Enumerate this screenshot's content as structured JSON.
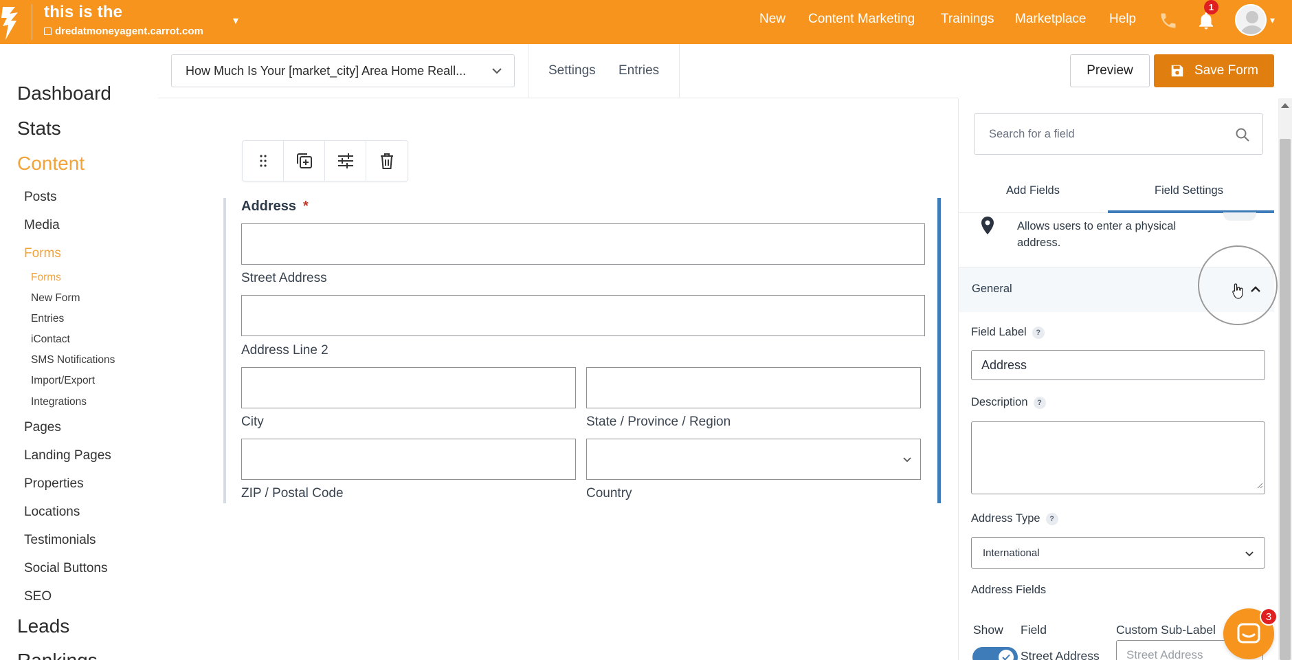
{
  "topbar": {
    "site_title": "this is the",
    "site_url": "dredatmoneyagent.carrot.com",
    "site_caret": "▾",
    "nav": [
      "New",
      "Content Marketing",
      "Trainings",
      "Marketplace",
      "Help"
    ],
    "notification_count": "1",
    "avatar_caret": "▾",
    "brand_color": "#f7941d"
  },
  "sidebar": {
    "dashboard": "Dashboard",
    "stats": "Stats",
    "content": "Content",
    "posts": "Posts",
    "media": "Media",
    "forms": "Forms",
    "forms_sub": [
      "Forms",
      "New Form",
      "Entries",
      "iContact",
      "SMS Notifications",
      "Import/Export",
      "Integrations"
    ],
    "pages": "Pages",
    "landing_pages": "Landing Pages",
    "properties": "Properties",
    "locations": "Locations",
    "testimonials": "Testimonials",
    "social_buttons": "Social Buttons",
    "seo": "SEO",
    "leads": "Leads",
    "rankings": "Rankings"
  },
  "header": {
    "form_name": "How Much Is Your [market_city] Area Home Reall...",
    "settings": "Settings",
    "entries": "Entries",
    "preview": "Preview",
    "save": "Save Form",
    "save_color": "#e07f10"
  },
  "canvas": {
    "toolbar_icons": [
      "drag-handle-icon",
      "duplicate-icon",
      "field-settings-icon",
      "trash-icon"
    ],
    "field_label": "Address",
    "required_mark": "*",
    "sublabels": {
      "street": "Street Address",
      "line2": "Address Line 2",
      "city": "City",
      "state": "State / Province / Region",
      "zip": "ZIP / Postal Code",
      "country": "Country"
    },
    "selected_accent": "#3d7cb8"
  },
  "panel": {
    "search_placeholder": "Search for a field",
    "tab_add": "Add Fields",
    "tab_settings": "Field Settings",
    "field_description": "Allows users to enter a physical address.",
    "general": "General",
    "field_label_title": "Field Label",
    "field_label_value": "Address",
    "description_title": "Description",
    "address_type_title": "Address Type",
    "address_type_value": "International",
    "address_fields_title": "Address Fields",
    "col_show": "Show",
    "col_field": "Field",
    "col_custom": "Custom Sub-Label",
    "row_field": "Street Address",
    "row_placeholder": "Street Address",
    "help": "?"
  },
  "chat": {
    "badge": "3"
  }
}
